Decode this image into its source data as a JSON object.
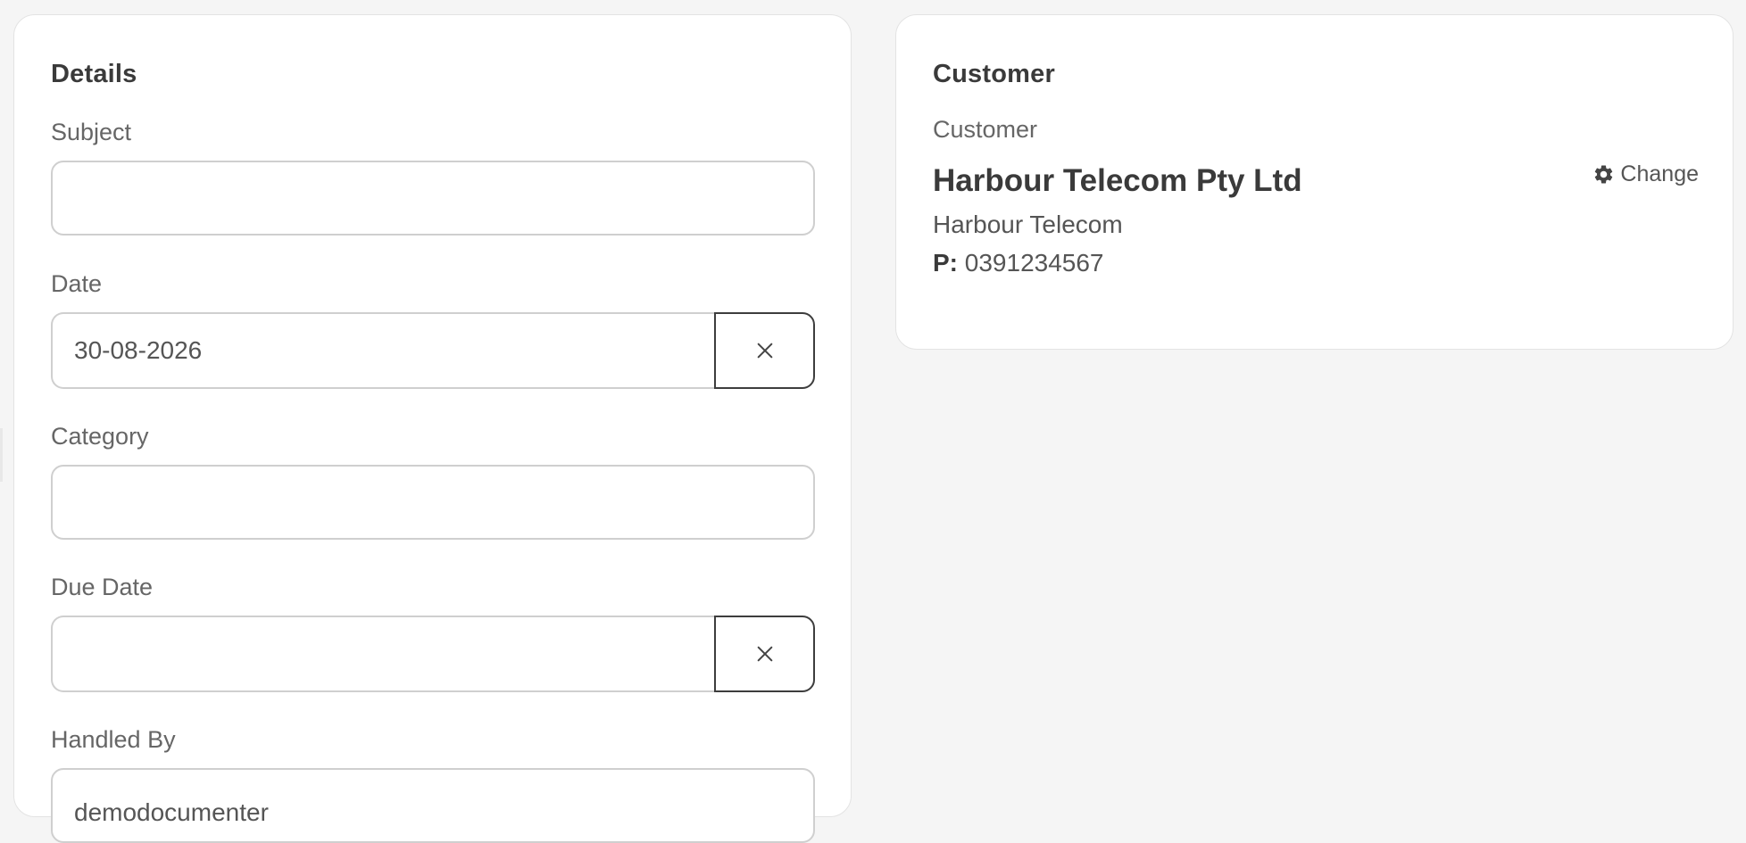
{
  "details": {
    "title": "Details",
    "subject": {
      "label": "Subject",
      "value": "",
      "placeholder": ""
    },
    "date": {
      "label": "Date",
      "value": "30-08-2026"
    },
    "category": {
      "label": "Category",
      "value": ""
    },
    "due_date": {
      "label": "Due Date",
      "value": ""
    },
    "handled_by": {
      "label": "Handled By",
      "value": "demodocumenter"
    }
  },
  "customer": {
    "title": "Customer",
    "label": "Customer",
    "name": "Harbour Telecom Pty Ltd",
    "trading_name": "Harbour Telecom",
    "phone_prefix": "P:",
    "phone": "0391234567",
    "change_label": "Change",
    "change_icon": "gear-icon"
  }
}
